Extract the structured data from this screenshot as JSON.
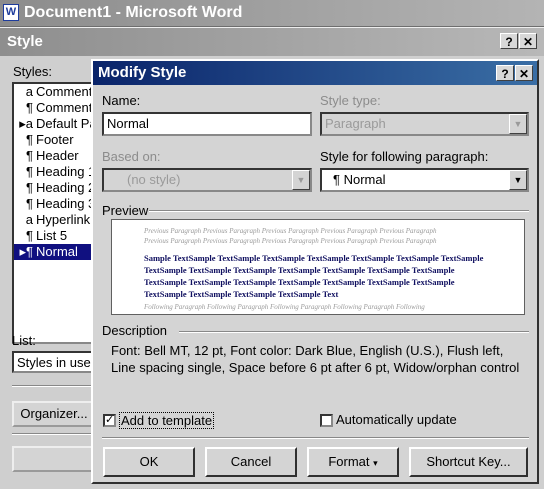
{
  "word_window": {
    "title": "Document1 - Microsoft Word",
    "icon": "word-app-icon",
    "icon_letter": "W"
  },
  "style_dialog": {
    "title": "Style",
    "help_button": "?",
    "close_button": "✕",
    "styles_label": "Styles:",
    "styles": [
      {
        "marker": "a",
        "name": "Comment"
      },
      {
        "marker": "¶",
        "name": "Comment"
      },
      {
        "marker": "▸a",
        "name": "Default Pa"
      },
      {
        "marker": "¶",
        "name": "Footer"
      },
      {
        "marker": "¶",
        "name": "Header"
      },
      {
        "marker": "¶",
        "name": "Heading 1"
      },
      {
        "marker": "¶",
        "name": "Heading 2"
      },
      {
        "marker": "¶",
        "name": "Heading 3"
      },
      {
        "marker": "a",
        "name": "Hyperlink"
      },
      {
        "marker": "¶",
        "name": "List 5"
      },
      {
        "marker": "▸¶",
        "name": "Normal"
      }
    ],
    "list_label": "List:",
    "list_value": "Styles in use",
    "organizer_button": "Organizer..."
  },
  "modify_style": {
    "title": "Modify Style",
    "help_button": "?",
    "close_button": "✕",
    "name_label": "Name:",
    "name_value": "Normal",
    "style_type_label": "Style type:",
    "style_type_value": "Paragraph",
    "based_on_label": "Based on:",
    "based_on_value": "(no style)",
    "following_label": "Style for following paragraph:",
    "following_value": "¶ Normal",
    "preview_label": "Preview",
    "preview": {
      "previous_lines": [
        "Previous Paragraph Previous Paragraph Previous Paragraph Previous Paragraph Previous Paragraph",
        "Previous Paragraph Previous Paragraph Previous Paragraph Previous Paragraph Previous Paragraph"
      ],
      "sample_text": "Sample TextSample TextSample TextSample TextSample TextSample TextSample TextSample TextSample TextSample TextSample TextSample TextSample TextSample TextSample TextSample TextSample TextSample TextSample TextSample TextSample TextSample TextSample TextSample TextSample TextSample Text",
      "following_line": "Following Paragraph Following Paragraph Following Paragraph Following Paragraph Following"
    },
    "description_label": "Description",
    "description_text": "Font: Bell MT, 12 pt, Font color: Dark Blue, English (U.S.), Flush left, Line spacing single, Space before 6 pt  after 6 pt, Widow/orphan control",
    "add_to_template_label": "Add to template",
    "add_to_template_checked": "✓",
    "auto_update_label": "Automatically update",
    "buttons": {
      "ok": "OK",
      "cancel": "Cancel",
      "format": "Format",
      "format_arrow": "▾",
      "shortcut": "Shortcut Key..."
    },
    "combo_arrow": "▼"
  }
}
